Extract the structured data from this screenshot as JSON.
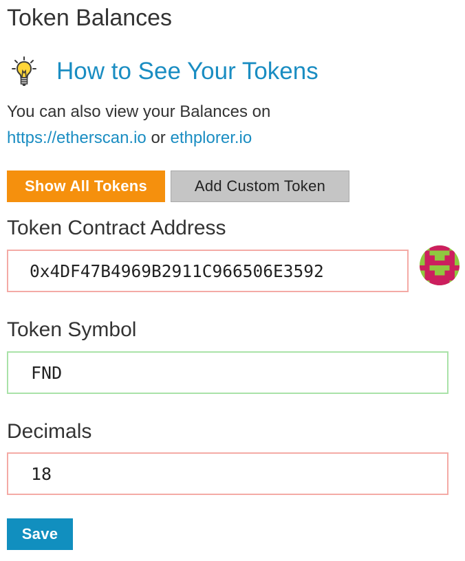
{
  "page": {
    "title": "Token Balances"
  },
  "howto": {
    "icon": "lightbulb-icon",
    "link_text": "How to See Your Tokens"
  },
  "info": {
    "prefix": "You can also view your Balances on",
    "link1": "https://etherscan.io",
    "separator": " or ",
    "link2": "ethplorer.io"
  },
  "buttons": {
    "show_all": "Show All Tokens",
    "add_custom": "Add Custom Token",
    "save": "Save"
  },
  "form": {
    "address": {
      "label": "Token Contract Address",
      "value": "0x4DF47B4969B2911C966506E3592"
    },
    "symbol": {
      "label": "Token Symbol",
      "value": "FND"
    },
    "decimals": {
      "label": "Decimals",
      "value": "18"
    }
  },
  "identicon": {
    "name": "address-identicon",
    "colors": {
      "background": "#8fc83f",
      "foreground": "#cc1f5e"
    }
  },
  "colors": {
    "accent_orange": "#f5900d",
    "link_blue": "#1a8dc2",
    "save_blue": "#118fbf",
    "invalid_border": "#f4aaa5",
    "valid_border": "#a9e2a8"
  }
}
